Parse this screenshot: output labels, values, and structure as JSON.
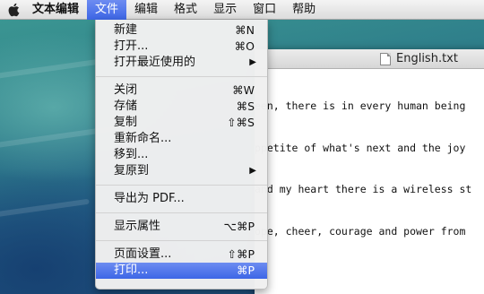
{
  "menubar": {
    "app_name": "文本编辑",
    "menus": [
      "文件",
      "编辑",
      "格式",
      "显示",
      "窗口",
      "帮助"
    ]
  },
  "document": {
    "title": "English.txt",
    "lines": [
      "een, there is in every human being",
      "ppetite of what's next and the joy",
      "and my heart there is a wireless st",
      "ope, cheer, courage and power from"
    ]
  },
  "file_menu": {
    "new": {
      "label": "新建",
      "shortcut": "⌘N"
    },
    "open": {
      "label": "打开...",
      "shortcut": "⌘O"
    },
    "open_recent": {
      "label": "打开最近使用的"
    },
    "close": {
      "label": "关闭",
      "shortcut": "⌘W"
    },
    "save": {
      "label": "存储",
      "shortcut": "⌘S"
    },
    "duplicate": {
      "label": "复制",
      "shortcut": "⇧⌘S"
    },
    "rename": {
      "label": "重新命名..."
    },
    "move_to": {
      "label": "移到..."
    },
    "revert_to": {
      "label": "复原到"
    },
    "export_pdf": {
      "label": "导出为 PDF..."
    },
    "show_properties": {
      "label": "显示属性",
      "shortcut": "⌥⌘P"
    },
    "page_setup": {
      "label": "页面设置...",
      "shortcut": "⇧⌘P"
    },
    "print": {
      "label": "打印...",
      "shortcut": "⌘P"
    }
  }
}
